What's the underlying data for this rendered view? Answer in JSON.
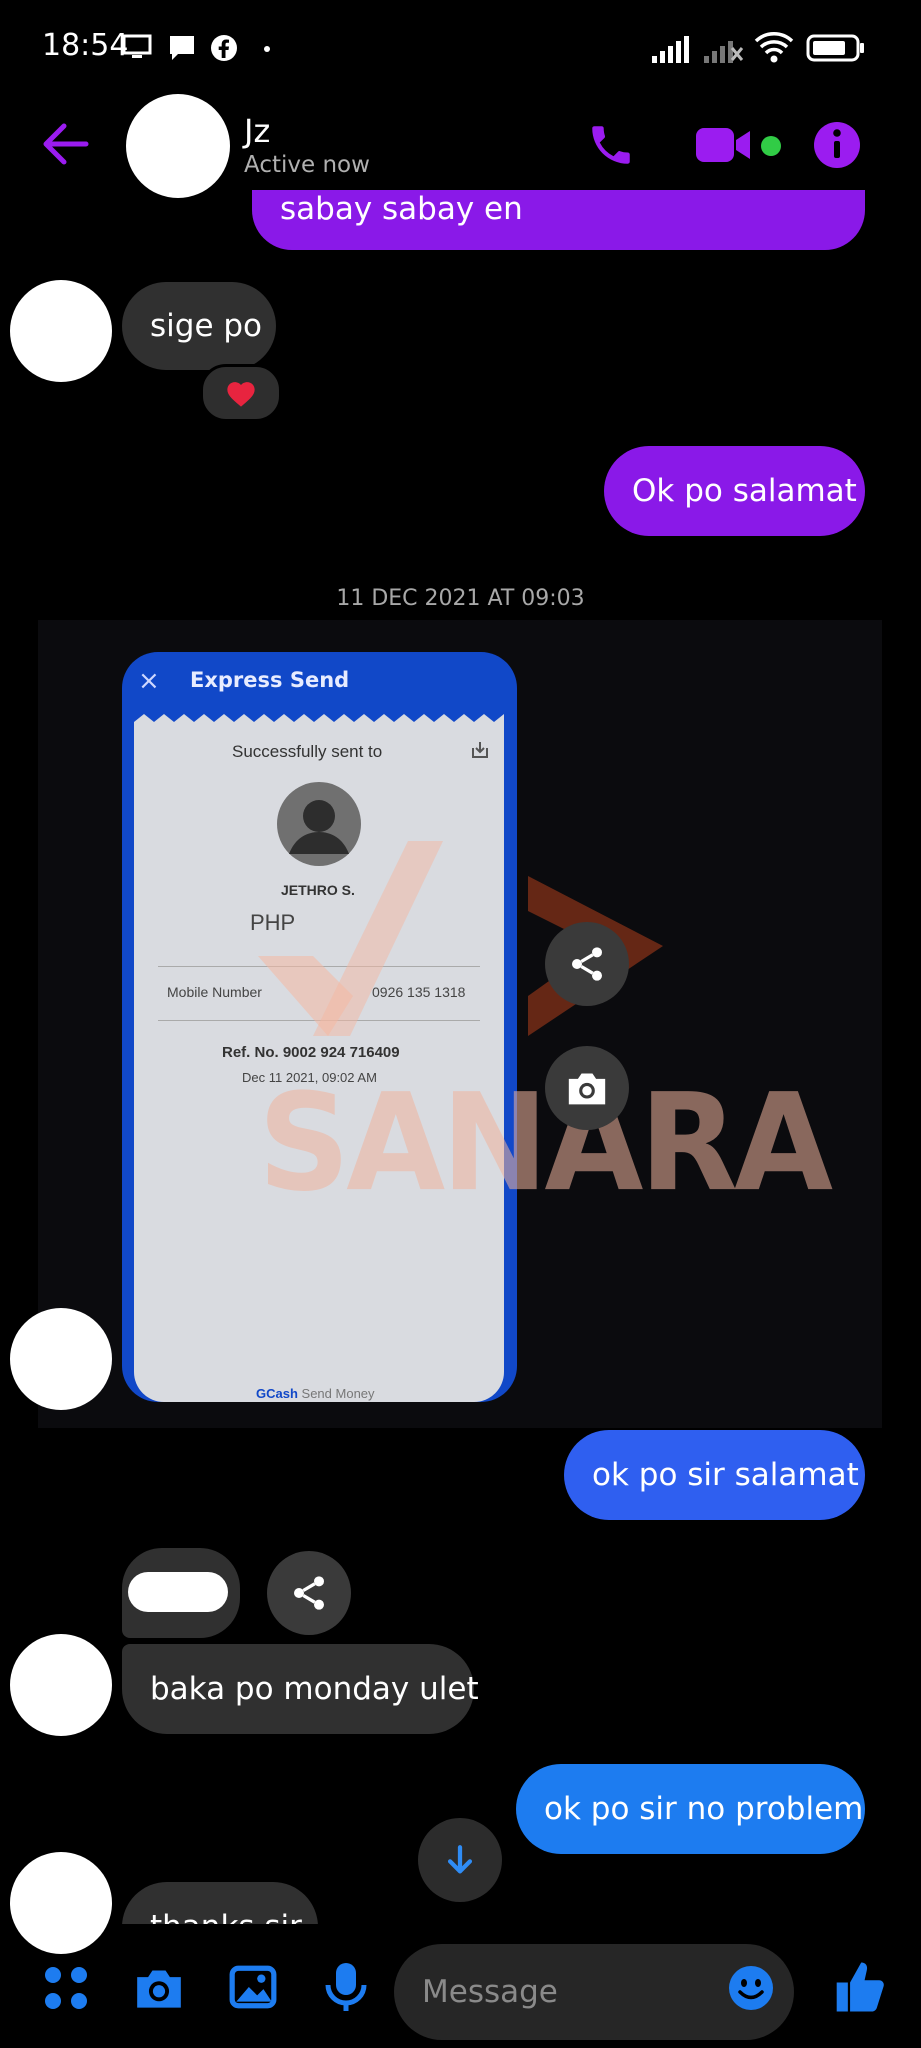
{
  "status": {
    "time": "18:54"
  },
  "header": {
    "name": "Jz",
    "status": "Active now"
  },
  "messages": {
    "top_partial": "sabay sabay en",
    "m1": "sige po",
    "reaction": "❤️",
    "m2": "Ok po salamat",
    "date": "11 DEC 2021 AT 09:03",
    "m3": "ok po sir salamat",
    "m4": "baka po monday ulet",
    "m5": "ok po sir no problem",
    "m6": "thanks sir"
  },
  "receipt": {
    "title": "Express Send",
    "close": "×",
    "sent_to": "Successfully sent to",
    "recipient": "JETHRO S.",
    "currency": "PHP",
    "mobile_label": "Mobile Number",
    "mobile_value": "0926 135 1318",
    "ref": "Ref. No. 9002 924 716409",
    "datetime": "Dec 11 2021, 09:02 AM",
    "footer_brand": "GCash",
    "footer_text": "Send Money",
    "watermark": "SANARA"
  },
  "composer": {
    "placeholder": "Message"
  },
  "colors": {
    "accent_purple": "#9b1cf0",
    "accent_blue": "#1d7cf0",
    "online": "#31cc46"
  }
}
